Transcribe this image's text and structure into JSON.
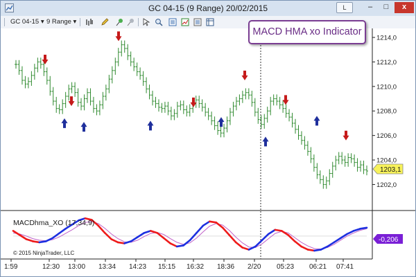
{
  "window": {
    "title": "GC 04-15 (9 Range)  20/02/2015",
    "btn_l": "L",
    "btn_min": "–",
    "btn_max": "□",
    "btn_close": "x"
  },
  "toolbar": {
    "instrument": "GC 04-15",
    "interval": "9 Range"
  },
  "callout": "MACD HMA xo Indicator",
  "price_axis": {
    "ticks": [
      "1214,0",
      "1212,0",
      "1210,0",
      "1208,0",
      "1206,0",
      "1204,0",
      "1202,0"
    ],
    "current_price": "1203,1",
    "current_color": "#f7f25a"
  },
  "indicator": {
    "label": "MACDhma_XO (17,34,9)",
    "value": "-0,206",
    "value_color": "#7a1fd6",
    "copyright": "© 2015 NinjaTrader, LLC"
  },
  "time_axis": [
    "1:59",
    "12:30",
    "13:00",
    "13:34",
    "14:23",
    "15:15",
    "16:32",
    "18:36",
    "2/20",
    "05:23",
    "06:21",
    "07:41"
  ],
  "colors": {
    "bars": "#2f8a2f",
    "up_arrow": "#1f2f9c",
    "down_arrow": "#c51a1a",
    "macd_up": "#1d2fe0",
    "macd_down": "#ee1b1b",
    "signal": "#c062c9"
  },
  "chart_data": {
    "type": "line",
    "title": "",
    "ylim": [
      1201,
      1215
    ],
    "price_closes": [
      1211.8,
      1211.3,
      1210.5,
      1210.2,
      1210.4,
      1210.9,
      1211.5,
      1212.0,
      1211.8,
      1211.2,
      1210.5,
      1209.6,
      1208.8,
      1208.2,
      1208.1,
      1208.6,
      1209.2,
      1209.8,
      1210.0,
      1209.5,
      1208.7,
      1208.4,
      1209.0,
      1209.5,
      1208.8,
      1208.2,
      1208.0,
      1208.5,
      1209.2,
      1209.8,
      1210.6,
      1211.3,
      1212.0,
      1212.8,
      1213.4,
      1213.1,
      1212.5,
      1212.0,
      1211.6,
      1211.2,
      1210.9,
      1210.4,
      1209.8,
      1209.3,
      1208.8,
      1208.6,
      1208.3,
      1208.2,
      1208.4,
      1208.0,
      1207.6,
      1207.8,
      1208.4,
      1208.5,
      1208.1,
      1207.9,
      1208.2,
      1208.6,
      1208.9,
      1208.6,
      1208.3,
      1207.9,
      1207.6,
      1207.2,
      1206.8,
      1206.4,
      1206.2,
      1206.6,
      1207.2,
      1207.9,
      1208.4,
      1208.8,
      1209.0,
      1209.3,
      1209.5,
      1209.3,
      1208.7,
      1207.9,
      1207.3,
      1206.9,
      1207.4,
      1208.0,
      1208.8,
      1209.0,
      1208.8,
      1208.5,
      1208.2,
      1207.8,
      1207.5,
      1207.0,
      1206.5,
      1206.0,
      1205.6,
      1205.2,
      1204.7,
      1204.1,
      1203.4,
      1202.8,
      1202.4,
      1202.0,
      1202.3,
      1202.9,
      1203.5,
      1204.0,
      1204.3,
      1204.0,
      1203.8,
      1204.2,
      1204.1,
      1203.8,
      1203.4,
      1203.6,
      1203.2,
      1203.1
    ],
    "up_signals": [
      1207.4,
      1207.1,
      1207.2,
      1207.5,
      1205.9,
      1207.6,
      1201.9
    ],
    "down_signals": [
      1211.8,
      1208.4,
      1213.7,
      1208.3,
      1210.5,
      1208.5,
      1205.6
    ],
    "macd": [
      0.1,
      0.02,
      -0.06,
      -0.1,
      -0.12,
      -0.1,
      -0.04,
      0.05,
      0.14,
      0.22,
      0.3,
      0.34,
      0.31,
      0.2,
      0.06,
      -0.06,
      -0.12,
      -0.14,
      -0.1,
      -0.02,
      0.06,
      0.1,
      0.06,
      -0.04,
      -0.14,
      -0.2,
      -0.18,
      -0.08,
      0.06,
      0.2,
      0.28,
      0.26,
      0.16,
      0.02,
      -0.12,
      -0.22,
      -0.26,
      -0.2,
      -0.08,
      0.04,
      0.12,
      0.1,
      0.02,
      -0.1,
      -0.2,
      -0.26,
      -0.28,
      -0.26,
      -0.2,
      -0.12,
      -0.04,
      0.04,
      0.1,
      0.14,
      0.16
    ],
    "signal": [
      0.06,
      0.04,
      0.0,
      -0.05,
      -0.08,
      -0.09,
      -0.07,
      -0.02,
      0.05,
      0.12,
      0.2,
      0.26,
      0.28,
      0.24,
      0.15,
      0.04,
      -0.05,
      -0.11,
      -0.12,
      -0.08,
      -0.01,
      0.05,
      0.07,
      0.03,
      -0.05,
      -0.12,
      -0.16,
      -0.13,
      -0.04,
      0.08,
      0.19,
      0.24,
      0.21,
      0.11,
      -0.02,
      -0.13,
      -0.21,
      -0.22,
      -0.15,
      -0.05,
      0.05,
      0.09,
      0.06,
      -0.03,
      -0.12,
      -0.19,
      -0.24,
      -0.25,
      -0.22,
      -0.16,
      -0.08,
      0.0,
      0.06,
      0.11,
      0.14
    ],
    "macd_ylim": [
      -0.4,
      0.45
    ]
  }
}
